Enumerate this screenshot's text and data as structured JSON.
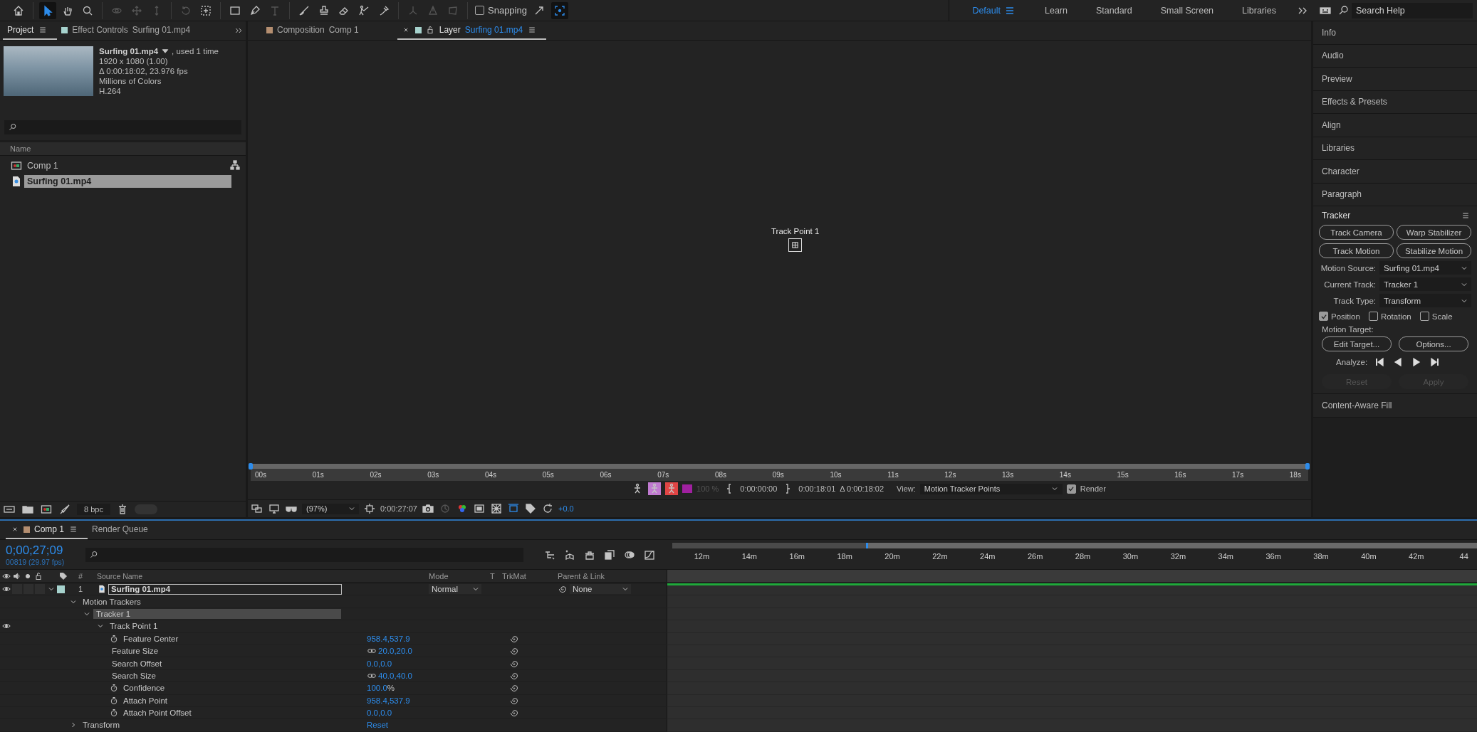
{
  "toolbar": {
    "tool_groups": [
      {
        "tools": [
          {
            "kind": "home",
            "selected": false,
            "disabled": false
          }
        ]
      },
      {
        "tools": [
          {
            "kind": "selection",
            "selected": true,
            "disabled": false
          },
          {
            "kind": "hand",
            "selected": false,
            "disabled": false
          },
          {
            "kind": "zoom",
            "selected": false,
            "disabled": false
          }
        ]
      },
      {
        "tools": [
          {
            "kind": "orbit",
            "selected": false,
            "disabled": true
          },
          {
            "kind": "move",
            "selected": false,
            "disabled": true
          },
          {
            "kind": "dolly",
            "selected": false,
            "disabled": true
          }
        ]
      },
      {
        "tools": [
          {
            "kind": "rotate",
            "selected": false,
            "disabled": true
          },
          {
            "kind": "anchor",
            "selected": false,
            "disabled": false
          }
        ]
      },
      {
        "tools": [
          {
            "kind": "rect",
            "selected": false,
            "disabled": false
          },
          {
            "kind": "pen",
            "selected": false,
            "disabled": false
          },
          {
            "kind": "type",
            "selected": false,
            "disabled": true
          }
        ]
      },
      {
        "tools": [
          {
            "kind": "brush",
            "selected": false,
            "disabled": false
          },
          {
            "kind": "stamp",
            "selected": false,
            "disabled": false
          },
          {
            "kind": "eraser",
            "selected": false,
            "disabled": false
          },
          {
            "kind": "roto",
            "selected": false,
            "disabled": false
          },
          {
            "kind": "puppet",
            "selected": false,
            "disabled": false
          }
        ]
      },
      {
        "tools": [
          {
            "kind": "localaxis",
            "selected": false,
            "disabled": true
          },
          {
            "kind": "worldaxis",
            "selected": false,
            "disabled": true
          },
          {
            "kind": "viewaxis",
            "selected": false,
            "disabled": true
          }
        ]
      }
    ],
    "snapping": {
      "label": "Snapping",
      "checked": false
    },
    "snap_tools": [
      {
        "kind": "expand",
        "selected": false,
        "disabled": false
      },
      {
        "kind": "gridbox",
        "selected": true,
        "disabled": false
      }
    ],
    "workspaces": [
      {
        "label": "Default",
        "selected": true
      },
      {
        "label": "Learn",
        "selected": false
      },
      {
        "label": "Standard",
        "selected": false
      },
      {
        "label": "Small Screen",
        "selected": false
      },
      {
        "label": "Libraries",
        "selected": false
      }
    ],
    "search": {
      "placeholder": "Search Help"
    }
  },
  "project_panel": {
    "tabs": [
      {
        "label": "Project",
        "selected": true
      },
      {
        "label": "Effect Controls",
        "target": "Surfing 01.mp4",
        "color": "#a6d2cd",
        "selected": false
      }
    ],
    "info": {
      "name": "Surfing 01.mp4",
      "usage": ", used 1 time",
      "lines": [
        "1920 x 1080 (1.00)",
        "Δ 0:00:18:02, 23.976 fps",
        "Millions of Colors",
        "H.264"
      ]
    },
    "column": "Name",
    "items": [
      {
        "kind": "comp",
        "label": "Comp 1",
        "selected": false
      },
      {
        "kind": "footage",
        "label": "Surfing 01.mp4",
        "selected": true
      }
    ],
    "bpc": "8 bpc"
  },
  "viewer": {
    "tabs": [
      {
        "label": "Composition",
        "target": "Comp 1",
        "color": "#b48e70",
        "selected": false
      },
      {
        "label": "Layer",
        "target": "Surfing 01.mp4",
        "color": "#a6d2cd",
        "selected": true
      }
    ],
    "track_point": "Track Point 1",
    "ruler": {
      "labels": [
        "00s",
        "01s",
        "02s",
        "03s",
        "04s",
        "05s",
        "06s",
        "07s",
        "08s",
        "09s",
        "10s",
        "11s",
        "12s",
        "13s",
        "14s",
        "15s",
        "16s",
        "17s",
        "18s"
      ],
      "playhead": {
        "level": 0
      }
    },
    "controls": {
      "zoom_level": "100 %",
      "in_point": "0:00:00:00",
      "out_point": "0:00:18:01",
      "duration": "Δ 0:00:18:02",
      "view_label": "View:",
      "view": "Motion Tracker Points",
      "render": {
        "label": "Render",
        "checked": true
      }
    },
    "bottom": {
      "magnification": "(97%)",
      "timecode": "0:00:27:07",
      "exposure": "+0.0"
    }
  },
  "right_panel": {
    "panels": [
      "Info",
      "Audio",
      "Preview",
      "Effects & Presets",
      "Align",
      "Libraries",
      "Character",
      "Paragraph"
    ],
    "tracker": {
      "title": "Tracker",
      "buttons": [
        "Track Camera",
        "Warp Stabilizer",
        "Track Motion",
        "Stabilize Motion"
      ],
      "fields": [
        {
          "label": "Motion Source:",
          "value": "Surfing 01.mp4"
        },
        {
          "label": "Current Track:",
          "value": "Tracker 1"
        },
        {
          "label": "Track Type:",
          "value": "Transform"
        }
      ],
      "checks": [
        {
          "label": "Position",
          "checked": true
        },
        {
          "label": "Rotation",
          "checked": false
        },
        {
          "label": "Scale",
          "checked": false
        }
      ],
      "target_label": "Motion Target:",
      "target_buttons": [
        "Edit Target...",
        "Options..."
      ],
      "analyze_label": "Analyze:",
      "actions": [
        {
          "label": "Reset",
          "disabled": true
        },
        {
          "label": "Apply",
          "disabled": true
        }
      ]
    },
    "bottom_panels": [
      "Content-Aware Fill"
    ]
  },
  "timeline": {
    "tabs": [
      {
        "label": "Comp 1",
        "color": "#b48e70",
        "selected": true
      },
      {
        "label": "Render Queue",
        "selected": false
      }
    ],
    "timecode": "0;00;27;09",
    "frame_info": "00819 (29.97 fps)",
    "columns": {
      "number": "#",
      "source": "Source Name",
      "mode": "Mode",
      "t": "T",
      "trkmat": "TrkMat",
      "parent": "Parent & Link"
    },
    "layer": {
      "visible": true,
      "expanded": true,
      "color": "#a6d2cd",
      "number": "1",
      "name": "Surfing 01.mp4",
      "mode": "Normal",
      "parent": "None"
    },
    "tree": [
      {
        "kind": "group",
        "label": "Motion Trackers",
        "expanded": true,
        "selected": false,
        "visible": false,
        "children": [
          {
            "kind": "group",
            "label": "Tracker 1",
            "expanded": true,
            "selected": true,
            "visible": false,
            "children": [
              {
                "kind": "group",
                "label": "Track Point 1",
                "expanded": true,
                "selected": false,
                "visible": true,
                "children": [
                  {
                    "kind": "property",
                    "label": "Feature Center",
                    "stopwatch": true,
                    "linked": false,
                    "value": "958.4,537.9",
                    "selected": false
                  },
                  {
                    "kind": "property",
                    "label": "Feature Size",
                    "stopwatch": false,
                    "linked": true,
                    "value": "20.0,20.0",
                    "selected": false
                  },
                  {
                    "kind": "property",
                    "label": "Search Offset",
                    "stopwatch": false,
                    "linked": false,
                    "value": "0.0,0.0",
                    "selected": false
                  },
                  {
                    "kind": "property",
                    "label": "Search Size",
                    "stopwatch": false,
                    "linked": true,
                    "value": "40.0,40.0",
                    "selected": false
                  },
                  {
                    "kind": "property",
                    "label": "Confidence",
                    "stopwatch": true,
                    "linked": false,
                    "value": "100.0",
                    "unit": "%",
                    "selected": false
                  },
                  {
                    "kind": "property",
                    "label": "Attach Point",
                    "stopwatch": true,
                    "linked": false,
                    "value": "958.4,537.9",
                    "selected": false
                  },
                  {
                    "kind": "property",
                    "label": "Attach Point Offset",
                    "stopwatch": true,
                    "linked": false,
                    "value": "0.0,0.0",
                    "selected": false
                  }
                ]
              }
            ]
          }
        ]
      },
      {
        "kind": "group",
        "label": "Transform",
        "expanded": false,
        "selected": false,
        "visible": false,
        "value": "Reset"
      }
    ],
    "ruler": [
      "12m",
      "14m",
      "16m",
      "18m",
      "20m",
      "22m",
      "24m",
      "26m",
      "28m",
      "30m",
      "32m",
      "34m",
      "36m",
      "38m",
      "40m",
      "42m",
      "44"
    ]
  }
}
